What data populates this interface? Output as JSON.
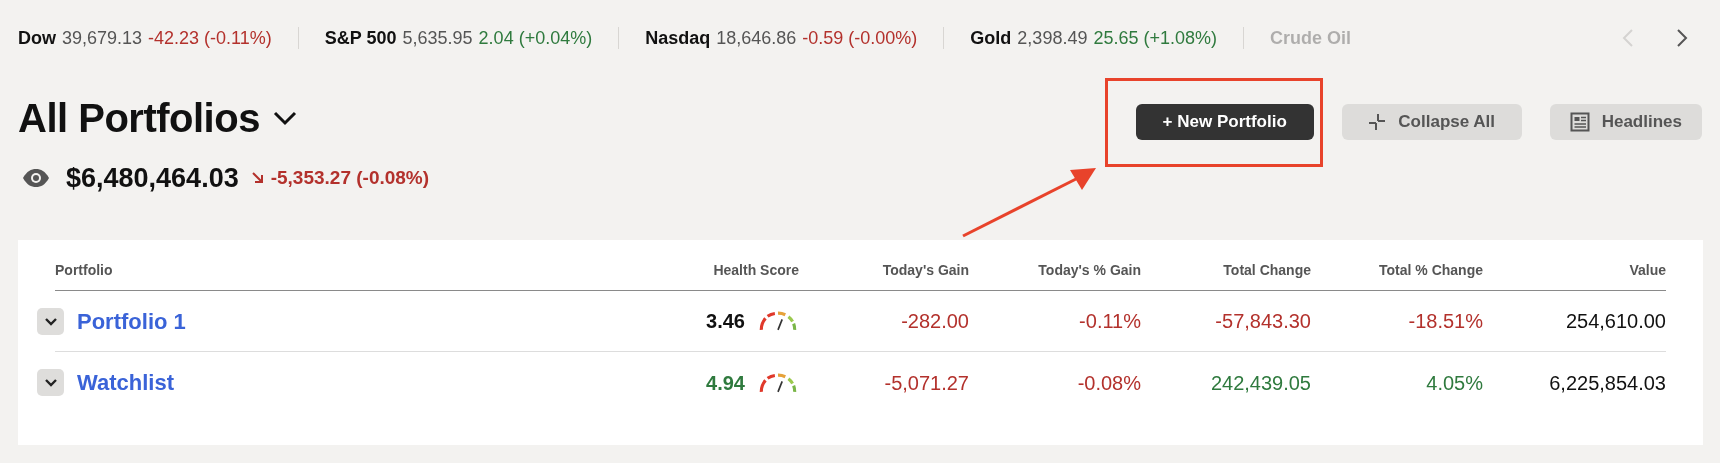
{
  "ticker": {
    "items": [
      {
        "name": "Dow",
        "price": "39,679.13",
        "change": "-42.23 (-0.11%)",
        "color": "#b3312c",
        "faded": false
      },
      {
        "name": "S&P 500",
        "price": "5,635.95",
        "change": "2.04 (+0.04%)",
        "color": "#2f7a3e",
        "faded": false
      },
      {
        "name": "Nasdaq",
        "price": "18,646.86",
        "change": "-0.59 (-0.00%)",
        "color": "#b3312c",
        "faded": false
      },
      {
        "name": "Gold",
        "price": "2,398.49",
        "change": "25.65 (+1.08%)",
        "color": "#2f7a3e",
        "faded": false
      },
      {
        "name": "Crude Oil",
        "faded": true
      }
    ],
    "prev_disabled": true,
    "next_disabled": false
  },
  "header": {
    "title": "All Portfolios",
    "total": "$6,480,464.03",
    "total_change": {
      "text": "-5,353.27 (-0.08%)",
      "color": "#b3312c"
    },
    "buttons": [
      {
        "label": "+ New Portfolio",
        "kind": "primary"
      },
      {
        "label": "Collapse All",
        "kind": "collapse"
      },
      {
        "label": "Headlines",
        "kind": "headlines"
      }
    ]
  },
  "table": {
    "columns": [
      "Portfolio",
      "Health Score",
      "Today's Gain",
      "Today's % Gain",
      "Total Change",
      "Total % Change",
      "Value"
    ],
    "rows": [
      {
        "name": "Portfolio 1",
        "expanded": false,
        "health_score": {
          "text": "3.46",
          "color": "#111111"
        },
        "todays_gain": {
          "text": "-282.00",
          "color": "#b3312c"
        },
        "todays_pct": {
          "text": "-0.11%",
          "color": "#b3312c"
        },
        "total_change": {
          "text": "-57,843.30",
          "color": "#b3312c"
        },
        "total_pct": {
          "text": "-18.51%",
          "color": "#b3312c"
        },
        "value": "254,610.00"
      },
      {
        "name": "Watchlist",
        "expanded": false,
        "health_score": {
          "text": "4.94",
          "color": "#2f7a3e"
        },
        "todays_gain": {
          "text": "-5,071.27",
          "color": "#b3312c"
        },
        "todays_pct": {
          "text": "-0.08%",
          "color": "#b3312c"
        },
        "total_change": {
          "text": "242,439.05",
          "color": "#2f7a3e"
        },
        "total_pct": {
          "text": "4.05%",
          "color": "#2f7a3e"
        },
        "value": "6,225,854.03"
      }
    ]
  }
}
